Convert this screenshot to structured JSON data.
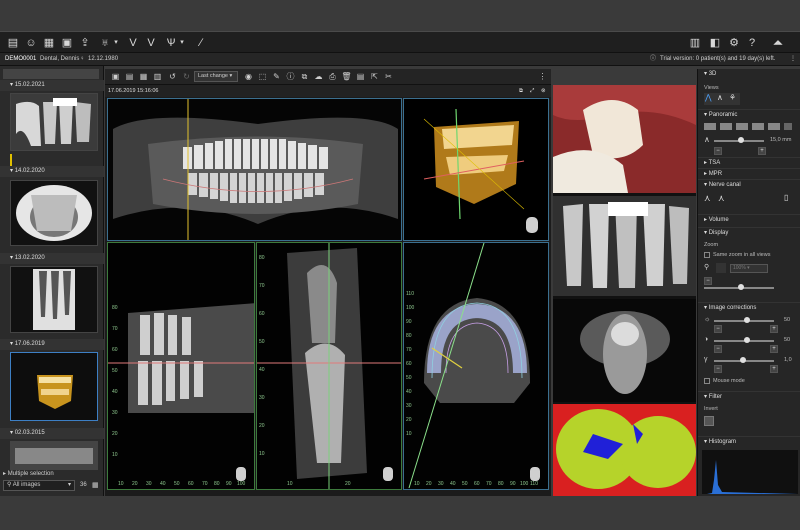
{
  "toolbar": {
    "icons": [
      "patient-file-icon",
      "patients-icon",
      "image-list-icon",
      "camera-import-icon",
      "export-icon",
      "tooth-icon",
      "dropdown-arrow-icon",
      "implant-icon",
      "nerve-icon",
      "crown-icon",
      "scalpel-icon"
    ],
    "right_icons": [
      "user-manual-icon",
      "license-icon",
      "settings-icon",
      "help-icon",
      "brand-logo"
    ]
  },
  "patient": {
    "id": "DEMO0001",
    "name": "Dental, Dennis",
    "birthdate": "12.12.1980",
    "trial": "Trial version: 0 patient(s) and 19 day(s) left."
  },
  "left": {
    "dates": [
      "15.02.2021",
      "14.02.2020",
      "13.02.2020",
      "17.06.2019",
      "02.03.2015"
    ],
    "multiple": "Multiple selection",
    "filter": "All images",
    "count": "36"
  },
  "viewer": {
    "toolbar_dropdown": "Last change",
    "timestamp": "17.06.2019 15:16:06"
  },
  "axis": {
    "left": [
      "80",
      "70",
      "60",
      "50",
      "40",
      "30",
      "20",
      "10"
    ],
    "mid": [
      "80",
      "70",
      "60",
      "50",
      "40",
      "30",
      "20",
      "10"
    ],
    "right": [
      "110",
      "100",
      "90",
      "80",
      "70",
      "60",
      "50",
      "40",
      "30",
      "20",
      "10"
    ],
    "bottom1": [
      "10",
      "20",
      "30",
      "40",
      "50",
      "60",
      "70",
      "80",
      "90",
      "100",
      "110"
    ],
    "bottom2": [
      "10",
      "20"
    ],
    "bottom3": [
      "10",
      "20",
      "30",
      "40",
      "50",
      "60",
      "70",
      "80",
      "90",
      "100",
      "110"
    ]
  },
  "right": {
    "title": "3D",
    "views": "Views",
    "panoramic": "Panoramic",
    "pan_value": "15,0 mm",
    "tsa": "TSA",
    "mpr": "MPR",
    "nerve": "Nerve canal",
    "volume": "Volume",
    "display": "Display",
    "zoom": "Zoom",
    "same_zoom": "Same zoom in all views",
    "zoom_value": "100%",
    "image_corr": "Image corrections",
    "corr_values": [
      "50",
      "50",
      "1,0"
    ],
    "mouse_mode": "Mouse mode",
    "filter": "Filter",
    "invert": "Invert",
    "histogram": "Histogram"
  }
}
